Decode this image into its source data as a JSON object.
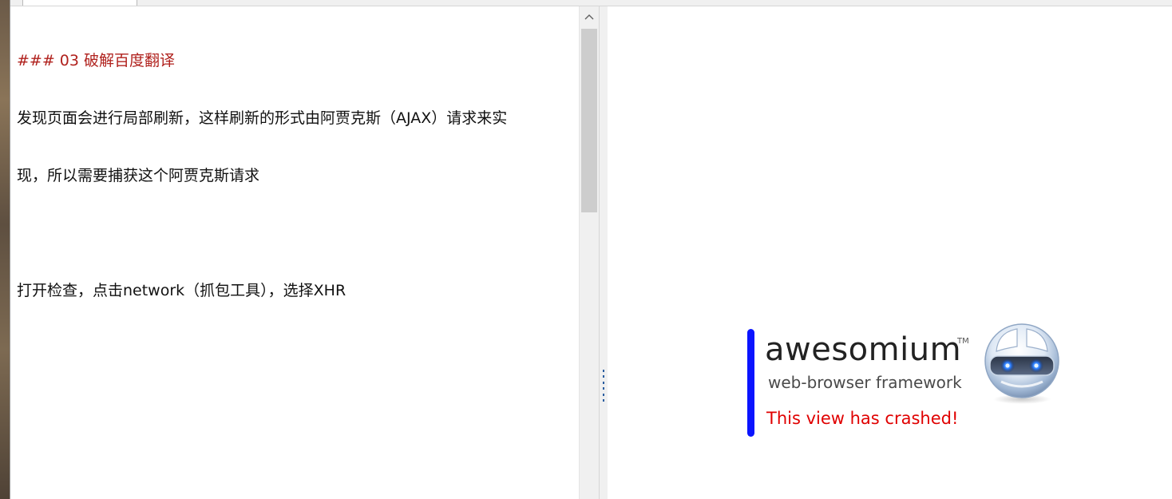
{
  "editor": {
    "heading": "### 03 破解百度翻译",
    "lines": [
      "发现页面会进行局部刷新，这样刷新的形式由阿贾克斯（AJAX）请求来实",
      "现，所以需要捕获这个阿贾克斯请求",
      "",
      "打开检查，点击network（抓包工具），选择XHR"
    ]
  },
  "preview": {
    "brand_name": "awesomium",
    "trademark": "TM",
    "tagline": "web-browser framework",
    "crash_message": "This view has crashed!",
    "colors": {
      "crash_bar": "#0a14ff",
      "crash_message": "#e00000",
      "heading": "#b0211d"
    },
    "logo_icon": "awesomium-robot-orb-icon"
  },
  "icons": {
    "scroll_up": "chevron-up-icon",
    "splitter_grip": "grip-dots-icon"
  }
}
